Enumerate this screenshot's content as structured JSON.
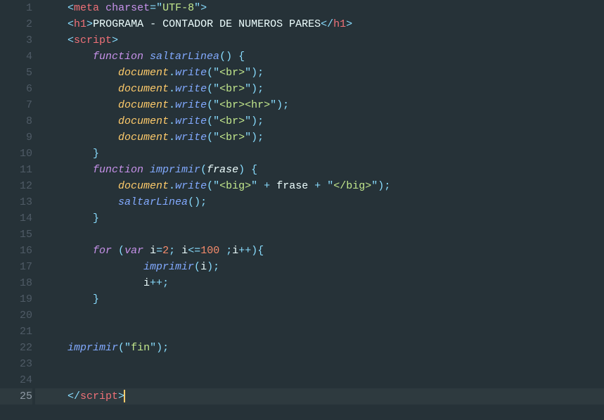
{
  "lines": [
    {
      "n": 1,
      "tokens": [
        {
          "t": "<",
          "c": "punct"
        },
        {
          "t": "meta",
          "c": "tag"
        },
        {
          "t": " "
        },
        {
          "t": "charset",
          "c": "attr"
        },
        {
          "t": "=",
          "c": "punct"
        },
        {
          "t": "\"",
          "c": "punct"
        },
        {
          "t": "UTF-8",
          "c": "str"
        },
        {
          "t": "\"",
          "c": "punct"
        },
        {
          "t": ">",
          "c": "punct"
        }
      ],
      "indent": 1
    },
    {
      "n": 2,
      "tokens": [
        {
          "t": "<",
          "c": "punct"
        },
        {
          "t": "h1",
          "c": "tag"
        },
        {
          "t": ">",
          "c": "punct"
        },
        {
          "t": "PROGRAMA - CONTADOR DE NUMEROS PARES",
          "c": "txt"
        },
        {
          "t": "</",
          "c": "punct"
        },
        {
          "t": "h1",
          "c": "tag"
        },
        {
          "t": ">",
          "c": "punct"
        }
      ],
      "indent": 1
    },
    {
      "n": 3,
      "tokens": [
        {
          "t": "<",
          "c": "punct"
        },
        {
          "t": "script",
          "c": "tag"
        },
        {
          "t": ">",
          "c": "punct"
        }
      ],
      "indent": 1
    },
    {
      "n": 4,
      "tokens": [
        {
          "t": "function",
          "c": "attr it"
        },
        {
          "t": " "
        },
        {
          "t": "saltarLinea",
          "c": "fn"
        },
        {
          "t": "()",
          "c": "punct"
        },
        {
          "t": " "
        },
        {
          "t": "{",
          "c": "punct"
        }
      ],
      "indent": 2
    },
    {
      "n": 5,
      "tokens": [
        {
          "t": "document",
          "c": "obj"
        },
        {
          "t": ".",
          "c": "punct"
        },
        {
          "t": "write",
          "c": "fn"
        },
        {
          "t": "(",
          "c": "punct"
        },
        {
          "t": "\"",
          "c": "punct"
        },
        {
          "t": "<br>",
          "c": "str"
        },
        {
          "t": "\"",
          "c": "punct"
        },
        {
          "t": ")",
          "c": "punct"
        },
        {
          "t": ";",
          "c": "punct"
        }
      ],
      "indent": 3
    },
    {
      "n": 6,
      "tokens": [
        {
          "t": "document",
          "c": "obj"
        },
        {
          "t": ".",
          "c": "punct"
        },
        {
          "t": "write",
          "c": "fn"
        },
        {
          "t": "(",
          "c": "punct"
        },
        {
          "t": "\"",
          "c": "punct"
        },
        {
          "t": "<br>",
          "c": "str"
        },
        {
          "t": "\"",
          "c": "punct"
        },
        {
          "t": ")",
          "c": "punct"
        },
        {
          "t": ";",
          "c": "punct"
        }
      ],
      "indent": 3
    },
    {
      "n": 7,
      "tokens": [
        {
          "t": "document",
          "c": "obj"
        },
        {
          "t": ".",
          "c": "punct"
        },
        {
          "t": "write",
          "c": "fn"
        },
        {
          "t": "(",
          "c": "punct"
        },
        {
          "t": "\"",
          "c": "punct"
        },
        {
          "t": "<br><hr>",
          "c": "str"
        },
        {
          "t": "\"",
          "c": "punct"
        },
        {
          "t": ")",
          "c": "punct"
        },
        {
          "t": ";",
          "c": "punct"
        }
      ],
      "indent": 3
    },
    {
      "n": 8,
      "tokens": [
        {
          "t": "document",
          "c": "obj"
        },
        {
          "t": ".",
          "c": "punct"
        },
        {
          "t": "write",
          "c": "fn"
        },
        {
          "t": "(",
          "c": "punct"
        },
        {
          "t": "\"",
          "c": "punct"
        },
        {
          "t": "<br>",
          "c": "str"
        },
        {
          "t": "\"",
          "c": "punct"
        },
        {
          "t": ")",
          "c": "punct"
        },
        {
          "t": ";",
          "c": "punct"
        }
      ],
      "indent": 3
    },
    {
      "n": 9,
      "tokens": [
        {
          "t": "document",
          "c": "obj"
        },
        {
          "t": ".",
          "c": "punct"
        },
        {
          "t": "write",
          "c": "fn"
        },
        {
          "t": "(",
          "c": "punct"
        },
        {
          "t": "\"",
          "c": "punct"
        },
        {
          "t": "<br>",
          "c": "str"
        },
        {
          "t": "\"",
          "c": "punct"
        },
        {
          "t": ")",
          "c": "punct"
        },
        {
          "t": ";",
          "c": "punct"
        }
      ],
      "indent": 3
    },
    {
      "n": 10,
      "tokens": [
        {
          "t": "}",
          "c": "punct"
        }
      ],
      "indent": 2
    },
    {
      "n": 11,
      "tokens": [
        {
          "t": "function",
          "c": "attr it"
        },
        {
          "t": " "
        },
        {
          "t": "imprimir",
          "c": "fn"
        },
        {
          "t": "(",
          "c": "punct"
        },
        {
          "t": "frase",
          "c": "ident it"
        },
        {
          "t": ")",
          "c": "punct"
        },
        {
          "t": " "
        },
        {
          "t": "{",
          "c": "punct"
        }
      ],
      "indent": 2
    },
    {
      "n": 12,
      "tokens": [
        {
          "t": "document",
          "c": "obj"
        },
        {
          "t": ".",
          "c": "punct"
        },
        {
          "t": "write",
          "c": "fn"
        },
        {
          "t": "(",
          "c": "punct"
        },
        {
          "t": "\"",
          "c": "punct"
        },
        {
          "t": "<big>",
          "c": "str"
        },
        {
          "t": "\"",
          "c": "punct"
        },
        {
          "t": " ",
          "c": ""
        },
        {
          "t": "+",
          "c": "op"
        },
        {
          "t": " ",
          "c": ""
        },
        {
          "t": "frase",
          "c": "ident"
        },
        {
          "t": " ",
          "c": ""
        },
        {
          "t": "+",
          "c": "op"
        },
        {
          "t": " ",
          "c": ""
        },
        {
          "t": "\"",
          "c": "punct"
        },
        {
          "t": "</big>",
          "c": "str"
        },
        {
          "t": "\"",
          "c": "punct"
        },
        {
          "t": ")",
          "c": "punct"
        },
        {
          "t": ";",
          "c": "punct"
        }
      ],
      "indent": 3
    },
    {
      "n": 13,
      "tokens": [
        {
          "t": "saltarLinea",
          "c": "fn"
        },
        {
          "t": "()",
          "c": "punct"
        },
        {
          "t": ";",
          "c": "punct"
        }
      ],
      "indent": 3
    },
    {
      "n": 14,
      "tokens": [
        {
          "t": "}",
          "c": "punct"
        }
      ],
      "indent": 2
    },
    {
      "n": 15,
      "tokens": [],
      "indent": 0
    },
    {
      "n": 16,
      "tokens": [
        {
          "t": "for",
          "c": "attr it"
        },
        {
          "t": " "
        },
        {
          "t": "(",
          "c": "punct"
        },
        {
          "t": "var",
          "c": "attr it"
        },
        {
          "t": " "
        },
        {
          "t": "i",
          "c": "ident"
        },
        {
          "t": "=",
          "c": "op"
        },
        {
          "t": "2",
          "c": "num"
        },
        {
          "t": ";",
          "c": "punct"
        },
        {
          "t": " "
        },
        {
          "t": "i",
          "c": "ident"
        },
        {
          "t": "<=",
          "c": "op"
        },
        {
          "t": "100",
          "c": "num"
        },
        {
          "t": " "
        },
        {
          "t": ";",
          "c": "punct"
        },
        {
          "t": "i",
          "c": "ident"
        },
        {
          "t": "++",
          "c": "op"
        },
        {
          "t": ")",
          "c": "punct"
        },
        {
          "t": "{",
          "c": "punct"
        }
      ],
      "indent": 2
    },
    {
      "n": 17,
      "tokens": [
        {
          "t": "imprimir",
          "c": "fn"
        },
        {
          "t": "(",
          "c": "punct"
        },
        {
          "t": "i",
          "c": "ident"
        },
        {
          "t": ")",
          "c": "punct"
        },
        {
          "t": ";",
          "c": "punct"
        }
      ],
      "indent": 4
    },
    {
      "n": 18,
      "tokens": [
        {
          "t": "i",
          "c": "ident"
        },
        {
          "t": "++",
          "c": "op"
        },
        {
          "t": ";",
          "c": "punct"
        }
      ],
      "indent": 4
    },
    {
      "n": 19,
      "tokens": [
        {
          "t": "}",
          "c": "punct"
        }
      ],
      "indent": 2
    },
    {
      "n": 20,
      "tokens": [],
      "indent": 0
    },
    {
      "n": 21,
      "tokens": [],
      "indent": 0
    },
    {
      "n": 22,
      "tokens": [
        {
          "t": "imprimir",
          "c": "fn"
        },
        {
          "t": "(",
          "c": "punct"
        },
        {
          "t": "\"",
          "c": "punct"
        },
        {
          "t": "fin",
          "c": "str"
        },
        {
          "t": "\"",
          "c": "punct"
        },
        {
          "t": ")",
          "c": "punct"
        },
        {
          "t": ";",
          "c": "punct"
        }
      ],
      "indent": 1
    },
    {
      "n": 23,
      "tokens": [],
      "indent": 0
    },
    {
      "n": 24,
      "tokens": [],
      "indent": 0
    },
    {
      "n": 25,
      "active": true,
      "cursorAfter": true,
      "tokens": [
        {
          "t": "</",
          "c": "punct"
        },
        {
          "t": "script",
          "c": "tag"
        },
        {
          "t": ">",
          "c": "punct"
        }
      ],
      "indent": 1
    }
  ],
  "indentUnit": "    "
}
